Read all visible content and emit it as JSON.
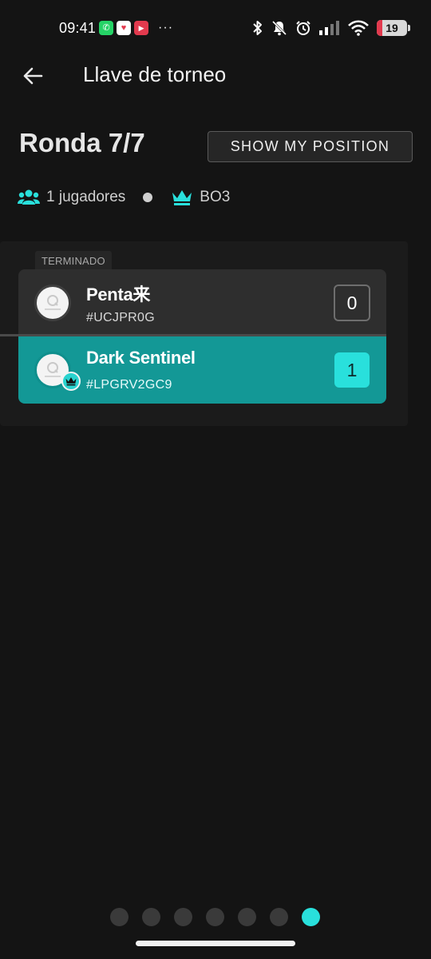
{
  "status_bar": {
    "time": "09:41",
    "battery_level": "19",
    "battery_fraction": 0.19,
    "notification_icons": [
      "whatsapp-icon",
      "heart-app-icon",
      "youtube-icon"
    ],
    "more": "···",
    "system_icons": [
      "bluetooth-icon",
      "bell-muted-icon",
      "alarm-icon",
      "signal-icon",
      "wifi-icon",
      "battery-icon"
    ]
  },
  "app_bar": {
    "title": "Llave de torneo",
    "back_icon": "arrow-left-icon"
  },
  "round": {
    "title": "Ronda 7/7",
    "show_position_label": "SHOW MY POSITION"
  },
  "meta": {
    "players_label": "1 jugadores",
    "players_icon": "people-icon",
    "format_label": "BO3",
    "format_icon": "crown-icon"
  },
  "match": {
    "status_label": "TERMINADO",
    "players": [
      {
        "name": "Penta来",
        "tag": "#UCJPR0G",
        "score": "0",
        "winner": false
      },
      {
        "name": "Dark Sentinel",
        "tag": "#LPGRV2GC9",
        "score": "1",
        "winner": true
      }
    ]
  },
  "pager": {
    "total": 7,
    "active_index": 6
  },
  "colors": {
    "background": "#141414",
    "accent": "#29e0dc",
    "winner_row": "#139896",
    "loser_row": "#2e2e2e"
  }
}
